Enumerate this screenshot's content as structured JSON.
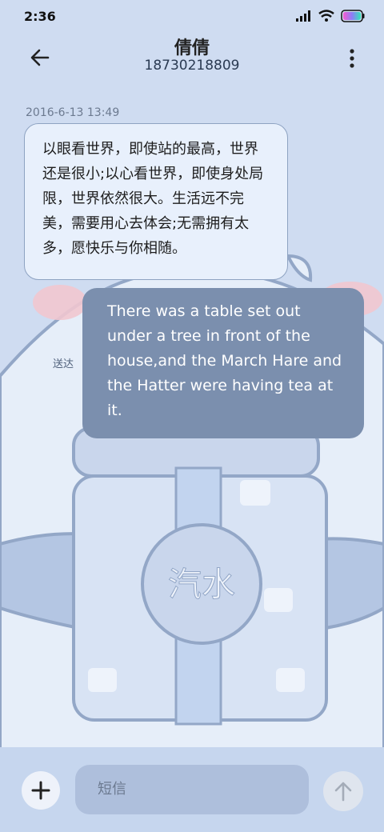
{
  "status_bar": {
    "time": "2:36"
  },
  "header": {
    "contact_name": "倩倩",
    "contact_number": "18730218809"
  },
  "conversation": {
    "timestamp": "2016-6-13 13:49",
    "incoming_message": "以眼看世界，即使站的最高，世界还是很小;以心看世界，即使身处局限，世界依然很大。生活远不完美，需要用心去体会;无需拥有太多，愿快乐与你相随。",
    "outgoing_message": "There was a table set out under a tree in front of the house,and the March Hare and the Hatter were having tea at it.",
    "sent_status": "送达"
  },
  "composer": {
    "placeholder": "短信"
  },
  "wallpaper": {
    "emblem_text": "汽水"
  },
  "colors": {
    "background": "#cfdcf1",
    "incoming_bubble": "#e8f0fc",
    "outgoing_bubble": "#7b8fae",
    "composer_bar": "#c6d6ee"
  }
}
